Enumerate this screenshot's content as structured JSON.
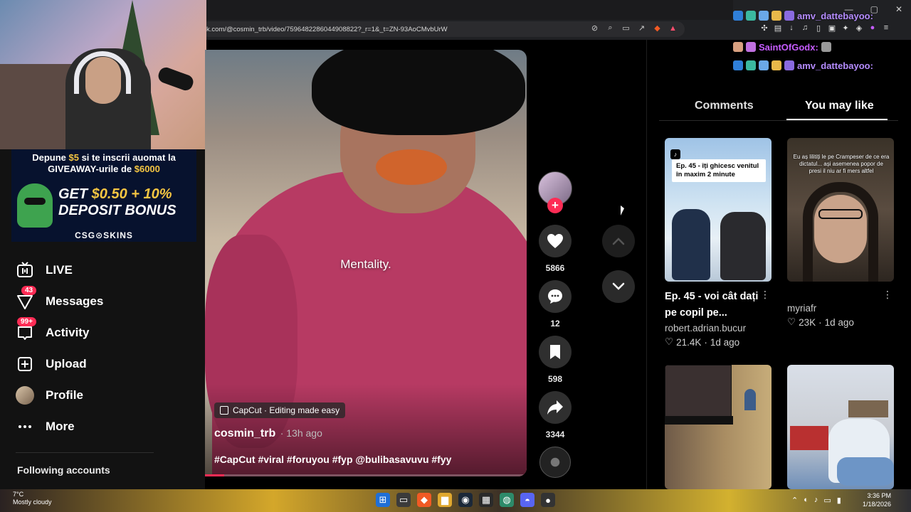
{
  "browser": {
    "url": "k.com/@cosmin_trb/video/7596482286044908822?_r=1&_t=ZN-93AoCMvbUrW",
    "window_controls": [
      "—",
      "▢",
      "✕"
    ]
  },
  "sidebar": {
    "items": [
      {
        "label": "LIVE",
        "icon": "live-icon",
        "badge": ""
      },
      {
        "label": "Messages",
        "icon": "messages-icon",
        "badge": "43"
      },
      {
        "label": "Activity",
        "icon": "activity-icon",
        "badge": "99+"
      },
      {
        "label": "Upload",
        "icon": "upload-icon",
        "badge": ""
      },
      {
        "label": "Profile",
        "icon": "profile-icon",
        "badge": ""
      },
      {
        "label": "More",
        "icon": "more-icon",
        "badge": ""
      }
    ],
    "following_title": "Following accounts"
  },
  "promo": {
    "line1_a": "Depune ",
    "line1_amount": "$5",
    "line1_b": " si te inscrii auomat la",
    "line2_a": "GIVEAWAY-urile de ",
    "line2_amount": "$6000",
    "bonus_line1_a": "GET ",
    "bonus_line1_amount": "$0.50 + 10%",
    "bonus_line2": "DEPOSIT BONUS",
    "brand": "CSG⊙SKINS"
  },
  "video": {
    "overlay_caption": "Mentality.",
    "capcut_label": "CapCut · Editing made easy",
    "author": "cosmin_trb",
    "time_ago": "· 13h ago",
    "hashtags": "#CapCut #viral #foruyou #fyp @bulibasavuvu #fyy",
    "progress": 0.06,
    "accent": "#fe2c55"
  },
  "actions": {
    "likes": "5866",
    "comments": "12",
    "saves": "598",
    "shares": "3344"
  },
  "right_panel": {
    "tabs": [
      {
        "label": "Comments",
        "active": false
      },
      {
        "label": "You may like",
        "active": true
      }
    ],
    "cards": [
      {
        "thumb_text": "Ep. 45 - îți ghicesc venitul în maxim 2 minute",
        "title": "Ep. 45 - voi cât dați pe copil pe...",
        "author": "robert.adrian.bucur",
        "likes": "21.4K",
        "ago": "1d ago"
      },
      {
        "thumb_text": "Eu aș lilitiți le pe Crampeser de ce era dictatul... ași asemenea popor de presi il niu ar fi mers altfel",
        "title": "",
        "author": "myriafr",
        "likes": "23K",
        "ago": "1d ago"
      },
      {
        "thumb_text": "",
        "title": "",
        "author": "",
        "likes": "",
        "ago": ""
      },
      {
        "thumb_text": "",
        "title": "",
        "author": "",
        "likes": "",
        "ago": ""
      }
    ]
  },
  "chat": [
    {
      "name": "amv_dattebayoo:",
      "color": "#b58cff"
    },
    {
      "name": "SaintOfGodx:",
      "color": "#c65cff"
    },
    {
      "name": "amv_dattebayoo:",
      "color": "#b58cff"
    }
  ],
  "taskbar": {
    "weather_temp": "7°C",
    "weather_desc": "Mostly cloudy",
    "time": "3:36 PM",
    "date": "1/18/2026"
  }
}
